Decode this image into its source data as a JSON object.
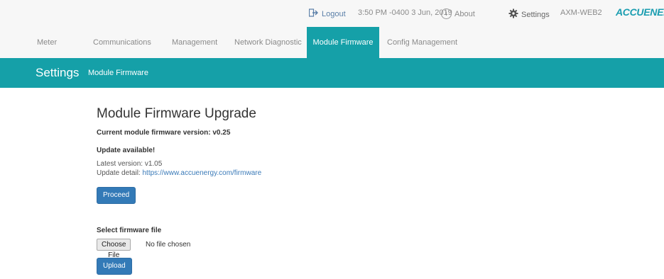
{
  "topbar": {
    "logout": "Logout",
    "datetime": "3:50 PM -0400 3 Jun, 2019",
    "about": "About",
    "settings": "Settings",
    "device": "AXM-WEB2",
    "brand": "ACCUENERGY",
    "icons": {
      "logout": "logout-icon",
      "about": "info-icon",
      "settings": "gear-icon"
    }
  },
  "tabs": [
    {
      "label": "Meter"
    },
    {
      "label": "Communications"
    },
    {
      "label": "Management"
    },
    {
      "label": "Network Diagnostic"
    },
    {
      "label": "Module Firmware",
      "active": true
    },
    {
      "label": "Config Management"
    }
  ],
  "banner": {
    "title": "Settings",
    "subtitle": "Module Firmware"
  },
  "main": {
    "heading": "Module Firmware Upgrade",
    "current_version": "Current module firmware version: v0.25",
    "update_available": "Update available!",
    "latest_version": "Latest version: v1.05",
    "update_detail_label": "Update detail:",
    "update_detail_link": "https://www.accuenergy.com/firmware",
    "proceed_button": "Proceed",
    "select_file_label": "Select firmware file",
    "choose_file_button": "Choose File",
    "no_file_text": "No file chosen",
    "upload_button": "Upload"
  },
  "colors": {
    "accent": "#15a0a8",
    "button": "#337ab7",
    "link": "#3a7ab8"
  }
}
